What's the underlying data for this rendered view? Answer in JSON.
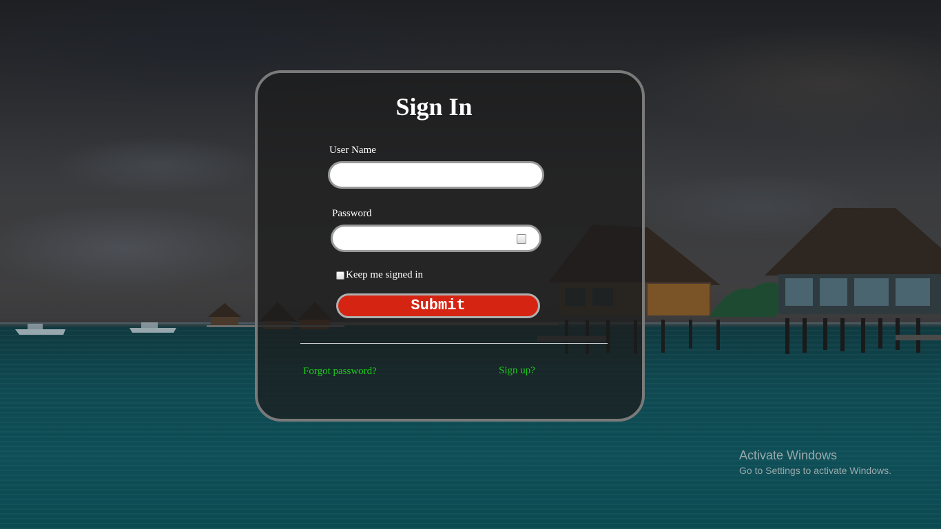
{
  "form": {
    "title": "Sign In",
    "username_label": "User Name",
    "username_value": "",
    "password_label": "Password",
    "password_value": "",
    "remember_label": "Keep me signed in",
    "remember_checked": false,
    "submit_label": "Submit",
    "forgot_link": "Forgot password?",
    "signup_link": "Sign up?"
  },
  "watermark": {
    "title": "Activate Windows",
    "subtitle": "Go to Settings to activate Windows."
  },
  "colors": {
    "submit_bg": "#d62412",
    "link": "#1ecb1e",
    "card_border": "#7a7a7a"
  }
}
